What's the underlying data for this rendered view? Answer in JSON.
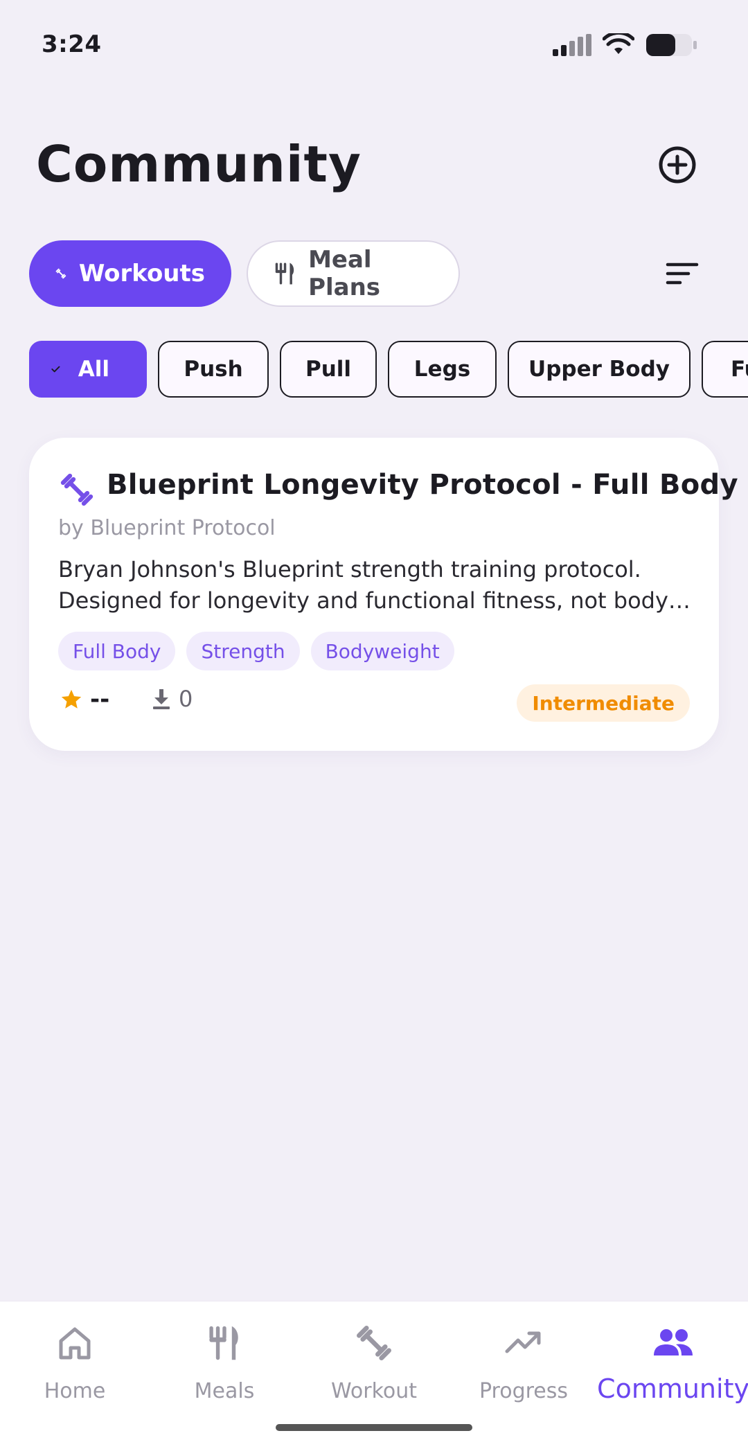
{
  "status": {
    "time": "3:24"
  },
  "header": {
    "title": "Community"
  },
  "segments": [
    {
      "label": "Workouts",
      "active": true
    },
    {
      "label": "Meal Plans",
      "active": false
    }
  ],
  "filters": [
    "All",
    "Push",
    "Pull",
    "Legs",
    "Upper Body",
    "Fu"
  ],
  "card": {
    "title": "Blueprint Longevity Protocol - Full Body",
    "author": "by Blueprint Protocol",
    "description_line1": "Bryan Johnson's Blueprint strength training protocol.",
    "description_line2": "Designed for longevity and functional fitness, not bodybuilding.",
    "tags": [
      "Full Body",
      "Strength",
      "Bodyweight"
    ],
    "rating": "--",
    "downloads": "0",
    "difficulty": "Intermediate"
  },
  "nav": {
    "items": [
      "Home",
      "Meals",
      "Workout",
      "Progress",
      "Community"
    ],
    "active": "Community"
  },
  "colors": {
    "accent": "#6B46F0",
    "background": "#F2EFF7",
    "tag_bg": "#F1ECFC",
    "difficulty_bg": "#FFF1E0",
    "difficulty_text": "#F08C00",
    "star": "#F5A000"
  },
  "icons": {
    "add": "add-circle-icon",
    "workouts": "dumbbell-icon",
    "meals": "fork-knife-icon",
    "sort": "sort-icon",
    "check": "check-icon",
    "rating": "star-icon",
    "downloads": "download-icon"
  }
}
